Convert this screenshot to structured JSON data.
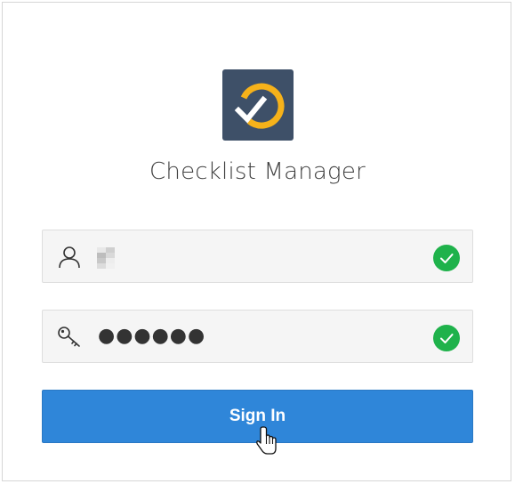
{
  "app": {
    "title": "Checklist Manager",
    "logo_icon": "checklist-logo-icon"
  },
  "username": {
    "icon": "user-icon",
    "value": "",
    "status_icon": "check-circle-icon"
  },
  "password": {
    "icon": "key-icon",
    "value": "●●●●●●",
    "status_icon": "check-circle-icon"
  },
  "signin": {
    "label": "Sign In"
  },
  "colors": {
    "logo_bg": "#3e5068",
    "logo_ring": "#f6b21a",
    "button": "#2f86d9",
    "valid": "#1fb24b"
  }
}
